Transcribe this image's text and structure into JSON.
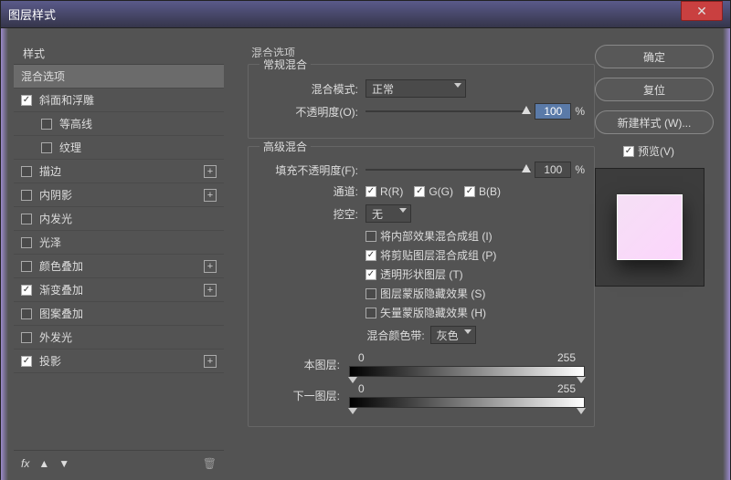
{
  "window": {
    "title": "图层样式"
  },
  "sidebar": {
    "header": "样式",
    "items": [
      {
        "label": "混合选项",
        "selected": true,
        "checkbox": false
      },
      {
        "label": "斜面和浮雕",
        "checked": true
      },
      {
        "label": "等高线",
        "indent": true,
        "checked": false
      },
      {
        "label": "纹理",
        "indent": true,
        "checked": false
      },
      {
        "label": "描边",
        "checked": false,
        "plus": true
      },
      {
        "label": "内阴影",
        "checked": false,
        "plus": true
      },
      {
        "label": "内发光",
        "checked": false
      },
      {
        "label": "光泽",
        "checked": false
      },
      {
        "label": "颜色叠加",
        "checked": false,
        "plus": true
      },
      {
        "label": "渐变叠加",
        "checked": true,
        "plus": true
      },
      {
        "label": "图案叠加",
        "checked": false
      },
      {
        "label": "外发光",
        "checked": false
      },
      {
        "label": "投影",
        "checked": true,
        "plus": true
      }
    ],
    "fx": "fx"
  },
  "main": {
    "title": "混合选项",
    "normal": {
      "legend": "常规混合",
      "blend_mode_label": "混合模式:",
      "blend_mode_value": "正常",
      "opacity_label": "不透明度(O):",
      "opacity_value": "100",
      "opacity_unit": "%"
    },
    "adv": {
      "legend": "高级混合",
      "fill_label": "填充不透明度(F):",
      "fill_value": "100",
      "fill_unit": "%",
      "channel_label": "通道:",
      "r": "R(R)",
      "g": "G(G)",
      "b": "B(B)",
      "knockout_label": "挖空:",
      "knockout_value": "无",
      "opts": [
        {
          "label": "将内部效果混合成组 (I)",
          "on": false
        },
        {
          "label": "将剪贴图层混合成组 (P)",
          "on": true
        },
        {
          "label": "透明形状图层 (T)",
          "on": true
        },
        {
          "label": "图层蒙版隐藏效果 (S)",
          "on": false
        },
        {
          "label": "矢量蒙版隐藏效果 (H)",
          "on": false
        }
      ],
      "band_label": "混合颜色带:",
      "band_value": "灰色",
      "this_label": "本图层:",
      "this_low": "0",
      "this_high": "255",
      "next_label": "下一图层:",
      "next_low": "0",
      "next_high": "255"
    }
  },
  "right": {
    "ok": "确定",
    "reset": "复位",
    "new": "新建样式 (W)...",
    "preview": "预览(V)"
  }
}
